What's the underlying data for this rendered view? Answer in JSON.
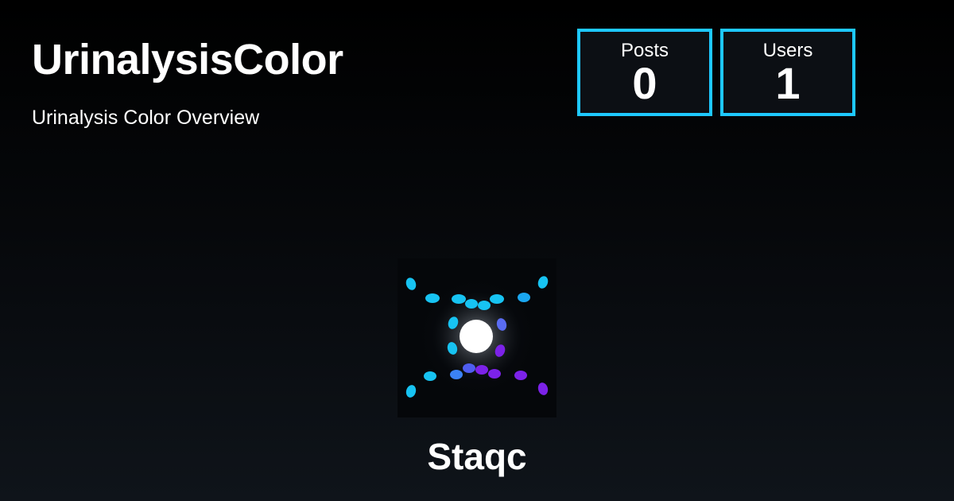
{
  "site": {
    "title": "UrinalysisColor",
    "subtitle": "Urinalysis Color Overview"
  },
  "stats": {
    "posts": {
      "label": "Posts",
      "value": "0"
    },
    "users": {
      "label": "Users",
      "value": "1"
    }
  },
  "user": {
    "name": "Staqc"
  },
  "colors": {
    "accent": "#1ec8ff",
    "logo_cyan": "#17c3f2",
    "logo_blue": "#3b82f6",
    "logo_purple": "#7c22e8",
    "logo_core": "#ffffff"
  },
  "icons": {
    "logo": "particle-burst-logo"
  }
}
